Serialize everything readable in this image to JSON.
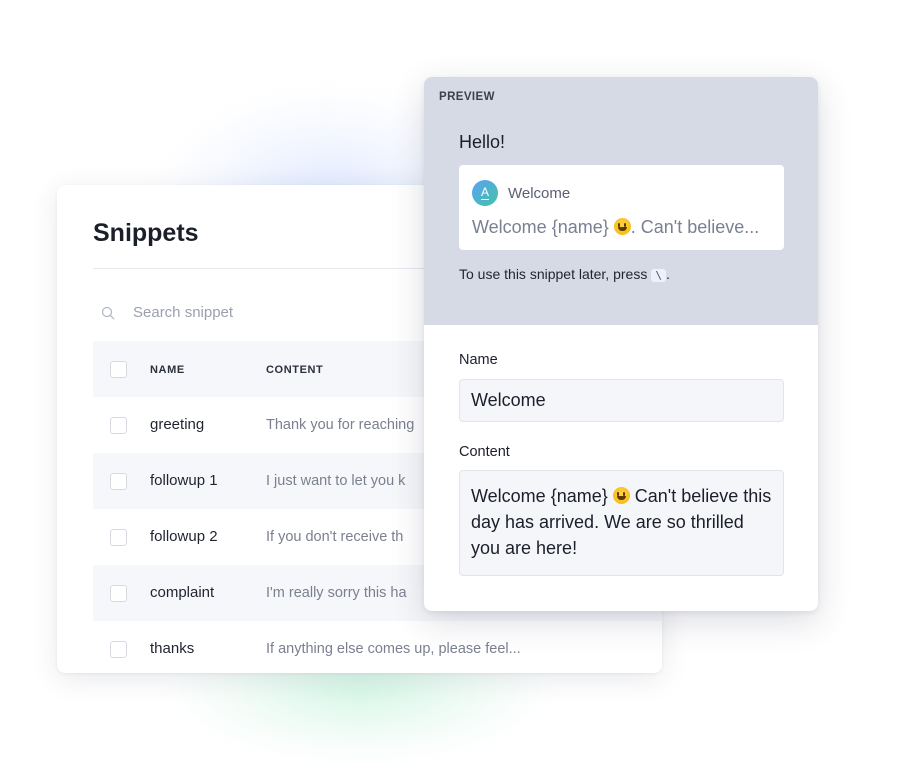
{
  "snippets": {
    "title": "Snippets",
    "search_placeholder": "Search snippet",
    "columns": {
      "name": "NAME",
      "content": "CONTENT"
    },
    "rows": [
      {
        "name": "greeting",
        "content": "Thank you for reaching"
      },
      {
        "name": "followup 1",
        "content": "I just want to let you k"
      },
      {
        "name": "followup 2",
        "content": "If you don't receive th"
      },
      {
        "name": "complaint",
        "content": "I'm really sorry this ha"
      },
      {
        "name": "thanks",
        "content": "If anything else comes up, please feel..."
      }
    ]
  },
  "preview": {
    "label": "PREVIEW",
    "greeting": "Hello!",
    "chip": {
      "avatar_letter": "A",
      "title": "Welcome",
      "body_before": "Welcome {name} ",
      "body_after": ". Can't believe..."
    },
    "hint_text": "To use this snippet later, press",
    "hint_key": "\\",
    "hint_end": ".",
    "form": {
      "name_label": "Name",
      "name_value": "Welcome",
      "content_label": "Content",
      "content_before": "Welcome {name} ",
      "content_after": " Can't believe this day has arrived. We are so thrilled you are here!"
    }
  },
  "icons": {
    "search": "search-icon",
    "emoji": "grinning-face-emoji"
  }
}
